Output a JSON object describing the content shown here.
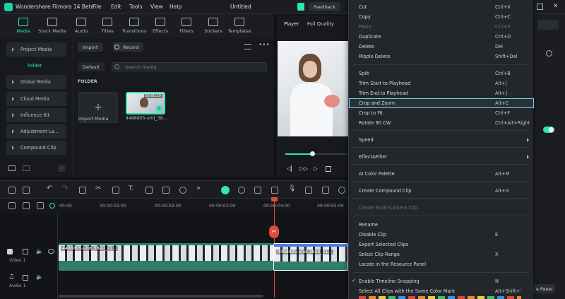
{
  "app": {
    "title": "Wondershare Filmora 14 Beta",
    "menu": [
      "File",
      "Edit",
      "Tools",
      "View",
      "Help"
    ],
    "project_name": "Untitled",
    "feedback_label": "Feedback"
  },
  "toolbar": {
    "tabs": [
      "Media",
      "Stock Media",
      "Audio",
      "Titles",
      "Transitions",
      "Effects",
      "Filters",
      "Stickers",
      "Templates"
    ],
    "active": "Media"
  },
  "leftnav": {
    "items": [
      "Project Media",
      "Folder",
      "Global Media",
      "Cloud Media",
      "Influence Kit",
      "Adjustment La...",
      "Compound Clip"
    ]
  },
  "media": {
    "import_label": "Import",
    "record_label": "Record",
    "sort_label": "Default",
    "search_placeholder": "Search media",
    "folder_heading": "FOLDER",
    "import_media_label": "Import Media",
    "clip_name": "4488805-uhd_38...",
    "clip_duration": "00:00:10"
  },
  "player": {
    "tab_player": "Player",
    "quality": "Full Quality"
  },
  "timeline": {
    "times": [
      "00:00",
      "00:00:01:00",
      "00:00:02:00",
      "00:00:03:00",
      "00:00:04:00",
      "00:00:05:00"
    ],
    "clip_label": "4488805-uhd_3840_21...",
    "clip_label2": "4488805-uhd_3840_21...",
    "video_track": "Video 1",
    "audio_track": "Audio 1"
  },
  "context_menu": {
    "items": [
      {
        "label": "Cut",
        "shortcut": "Ctrl+X",
        "disabled": false
      },
      {
        "label": "Copy",
        "shortcut": "Ctrl+C",
        "disabled": false
      },
      {
        "label": "Paste",
        "shortcut": "Ctrl+V",
        "disabled": true
      },
      {
        "label": "Duplicate",
        "shortcut": "Ctrl+D",
        "disabled": false
      },
      {
        "label": "Delete",
        "shortcut": "Del",
        "disabled": false
      },
      {
        "label": "Ripple Delete",
        "shortcut": "Shift+Del",
        "disabled": false
      },
      {
        "label": "Split",
        "shortcut": "Ctrl+B",
        "disabled": false
      },
      {
        "label": "Trim Start to Playhead",
        "shortcut": "Alt+[",
        "disabled": false
      },
      {
        "label": "Trim End to Playhead",
        "shortcut": "Alt+]",
        "disabled": false
      },
      {
        "label": "Crop and Zoom",
        "shortcut": "Alt+C",
        "disabled": false,
        "highlighted": true
      },
      {
        "label": "Crop to Fit",
        "shortcut": "Ctrl+F",
        "disabled": false
      },
      {
        "label": "Rotate 90 CW",
        "shortcut": "Ctrl+Alt+Right",
        "disabled": false
      },
      {
        "label": "Speed",
        "shortcut": "",
        "submenu": true
      },
      {
        "label": "Effect&Filter",
        "shortcut": "",
        "submenu": true
      },
      {
        "label": "AI Color Palette",
        "shortcut": "Alt+M",
        "disabled": false
      },
      {
        "label": "Create Compound Clip",
        "shortcut": "Alt+G",
        "disabled": false
      },
      {
        "label": "Create Multi-Camera Clip",
        "shortcut": "",
        "disabled": true
      },
      {
        "label": "Rename",
        "shortcut": "",
        "disabled": false
      },
      {
        "label": "Disable Clip",
        "shortcut": "E",
        "disabled": false
      },
      {
        "label": "Export Selected Clips",
        "shortcut": "",
        "disabled": false
      },
      {
        "label": "Select Clip Range",
        "shortcut": "X",
        "disabled": false
      },
      {
        "label": "Locate in the Resource Panel",
        "shortcut": "",
        "disabled": false
      },
      {
        "label": "Enable Timeline Snapping",
        "shortcut": "N",
        "checked": true
      },
      {
        "label": "Select All Clips with the Same Color Mark",
        "shortcut": "Alt+Shift+`"
      }
    ]
  },
  "right_panel": {
    "partial_button": "e Panel"
  },
  "colors": {
    "accent": "#2ee6b6",
    "highlight_border": "#66d9f0",
    "playhead": "#e04a3a"
  }
}
